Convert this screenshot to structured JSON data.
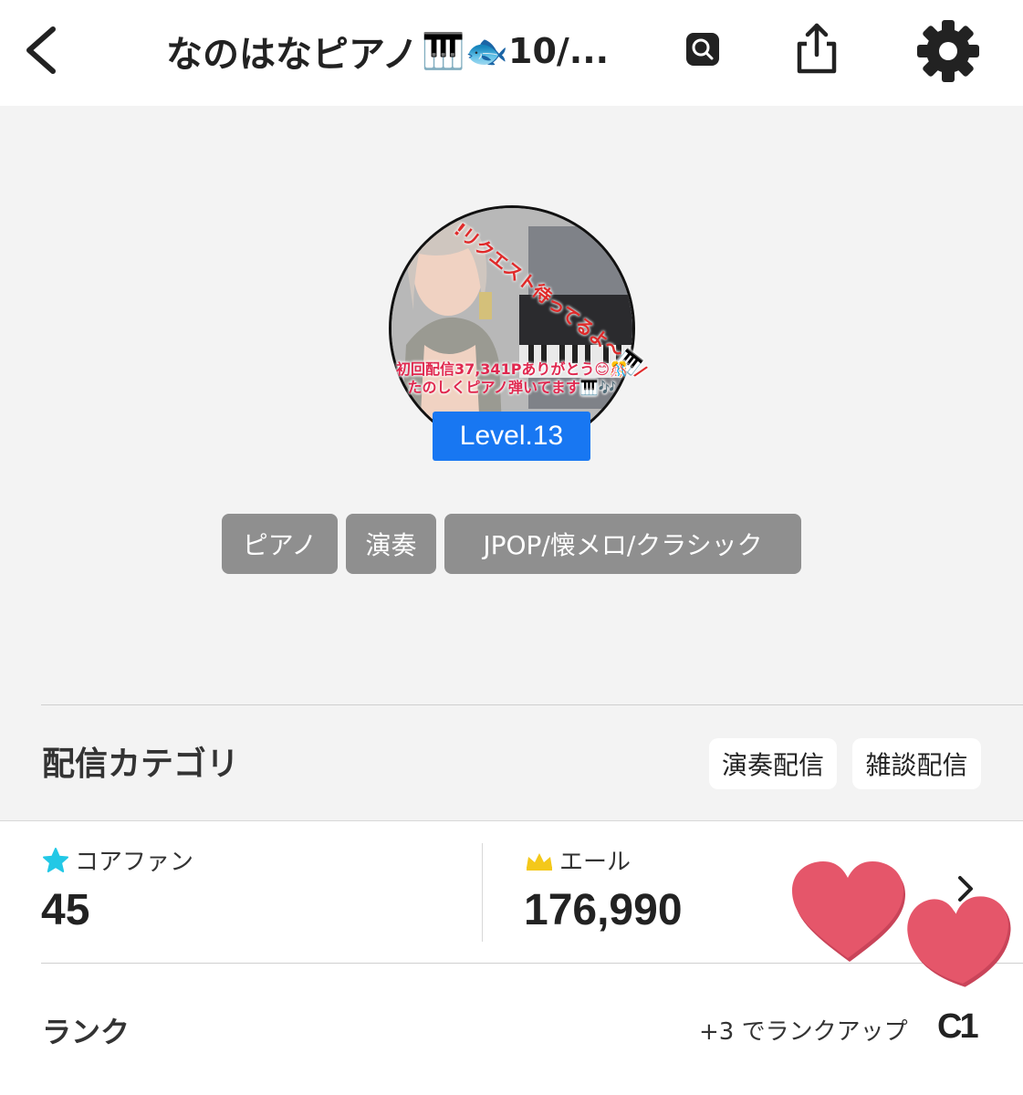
{
  "header": {
    "title": "なのはなピアノ",
    "title_suffix": "🎹🐟10/...",
    "back_icon": "chevron-left-icon",
    "share_icon": "share-icon",
    "settings_icon": "gear-icon"
  },
  "profile": {
    "avatar_overlay_top": "!リクエスト待ってるよ〜🎹/",
    "avatar_overlay_line1": "初回配信37,341Pありがとう😊🎊",
    "avatar_overlay_line2": "たのしくピアノ弾いてます🎹🎶",
    "level": "Level.13",
    "level_color": "#1877f2",
    "tags": [
      "ピアノ",
      "演奏",
      "JPOP/懐メロ/クラシック"
    ]
  },
  "category": {
    "label": "配信カテゴリ",
    "chips": [
      "演奏配信",
      "雑談配信"
    ]
  },
  "stats": {
    "core_fan_label": "コアファン",
    "core_fan_value": "45",
    "yell_label": "エール",
    "yell_value": "176,990",
    "core_fan_icon": "star-icon",
    "yell_icon": "crown-icon"
  },
  "rank": {
    "label": "ランク",
    "hint": "+3 でランクアップ",
    "badge": "C1"
  },
  "colors": {
    "background_grey": "#f3f3f3",
    "tag_grey": "#8f8f8f",
    "heart": "#e5566a",
    "star_cyan": "#22c8e6",
    "crown_yellow": "#f4c81a"
  }
}
